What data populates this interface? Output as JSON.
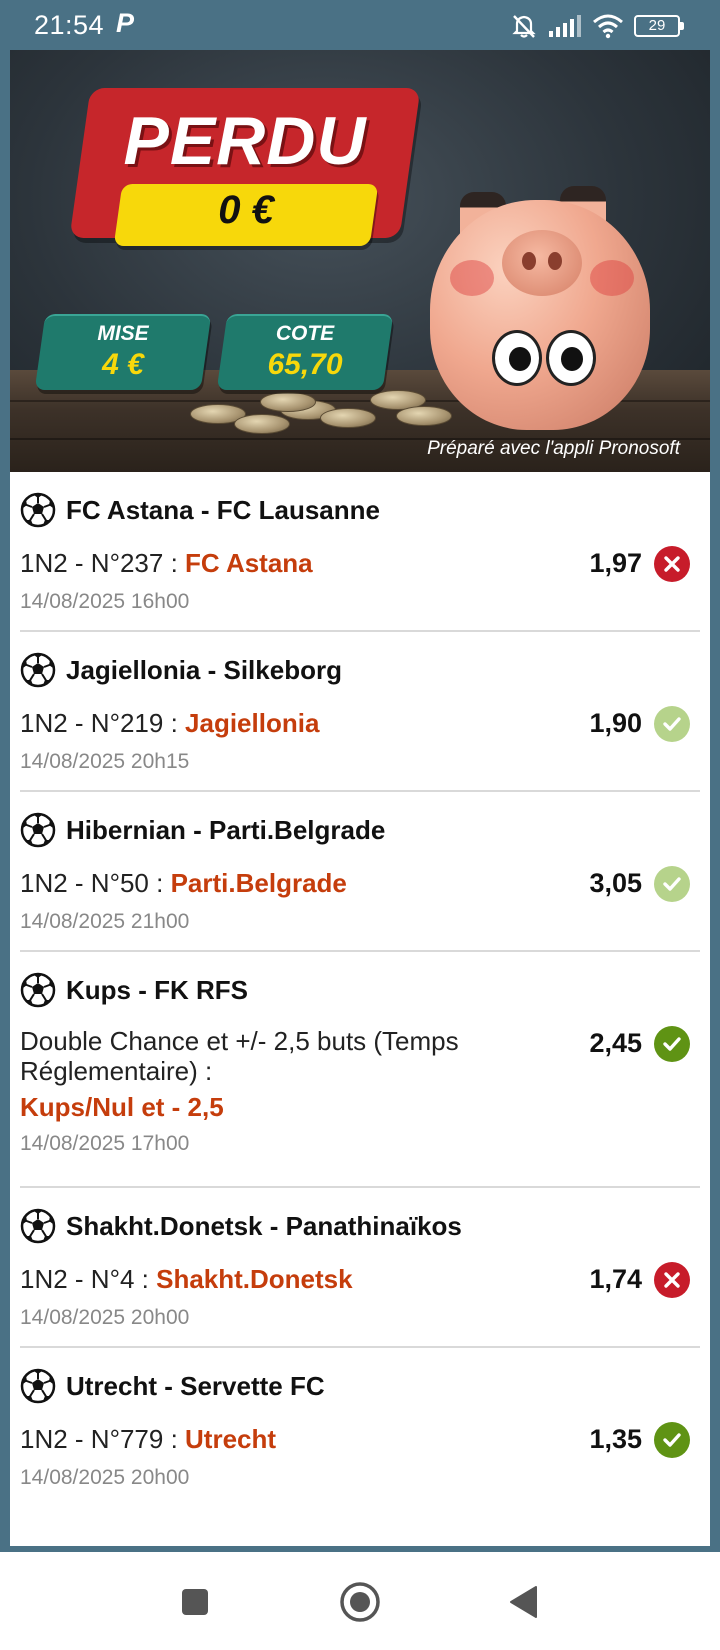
{
  "status_bar": {
    "time": "21:54",
    "app_letter": "P",
    "battery": "29"
  },
  "banner": {
    "result": "PERDU",
    "amount": "0 €",
    "stake_label": "MISE",
    "stake_value": "4 €",
    "odds_label": "COTE",
    "odds_value": "65,70",
    "footer": "Préparé avec l'appli Pronosoft"
  },
  "bets": [
    {
      "match": "FC Astana - FC Lausanne",
      "bet_type": "1N2 - N°237 : ",
      "selection": "FC Astana",
      "odds": "1,97",
      "date": "14/08/2025 16h00",
      "status": "lost"
    },
    {
      "match": "Jagiellonia - Silkeborg",
      "bet_type": "1N2 - N°219 : ",
      "selection": "Jagiellonia",
      "odds": "1,90",
      "date": "14/08/2025 20h15",
      "status": "won-light"
    },
    {
      "match": "Hibernian - Parti.Belgrade",
      "bet_type": "1N2 - N°50 : ",
      "selection": "Parti.Belgrade",
      "odds": "3,05",
      "date": "14/08/2025 21h00",
      "status": "won-light"
    },
    {
      "match": "Kups - FK RFS",
      "bet_type": "Double Chance et +/- 2,5 buts (Temps Réglementaire) :",
      "selection": "Kups/Nul et - 2,5",
      "odds": "2,45",
      "date": "14/08/2025 17h00",
      "status": "won"
    },
    {
      "match": "Shakht.Donetsk - Panathinaïkos",
      "bet_type": "1N2 - N°4 : ",
      "selection": "Shakht.Donetsk",
      "odds": "1,74",
      "date": "14/08/2025 20h00",
      "status": "lost"
    },
    {
      "match": "Utrecht - Servette FC",
      "bet_type": "1N2 - N°779 : ",
      "selection": "Utrecht",
      "odds": "1,35",
      "date": "14/08/2025 20h00",
      "status": "won"
    }
  ],
  "colors": {
    "status_bar_bg": "#4a7185",
    "selection_text": "#c53d0c",
    "lost": "#c71c2a",
    "won": "#5f9314",
    "won_light": "#b6d38b",
    "banner_red": "#c6262b",
    "banner_yellow": "#f7d80b",
    "tag_green": "#1f7a6c"
  },
  "icons": {
    "sport": "soccer-ball-icon",
    "lost": "x-circle-icon",
    "won": "check-circle-icon",
    "nav": [
      "square-recents-icon",
      "circle-home-icon",
      "triangle-back-icon"
    ]
  }
}
